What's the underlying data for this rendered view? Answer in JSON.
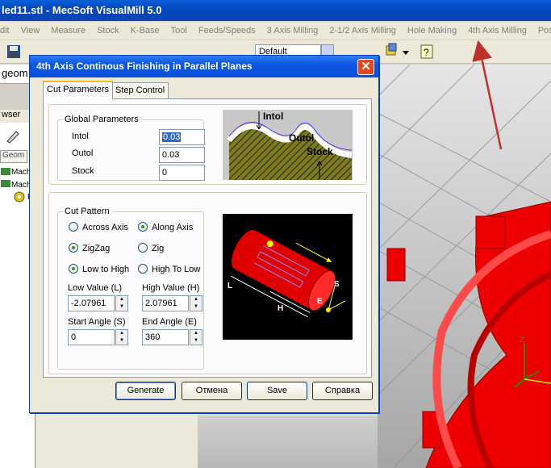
{
  "app": {
    "title": "led11.stl - MecSoft VisualMill 5.0",
    "menus": [
      "dit",
      "View",
      "Measure",
      "Stock",
      "K-Base",
      "Tool",
      "Feeds/Speeds",
      "3 Axis Milling",
      "2-1/2 Axis Milling",
      "Hole Making",
      "4th Axis Milling",
      "Post Pro"
    ],
    "toolbar_combo": "Default",
    "left_strip_text": "geom",
    "browser_caption": "wser",
    "geom_tab": "Geom",
    "tree": [
      "Mach",
      "Mach",
      "P"
    ]
  },
  "dialog": {
    "title": "4th Axis Continous Finishing in Parallel Planes",
    "close_label": "✕",
    "tabs": [
      "Cut Parameters",
      "Step Control"
    ],
    "global": {
      "legend": "Global Parameters",
      "intol_label": "Intol",
      "intol_value": "0.03",
      "outol_label": "Outol",
      "outol_value": "0.03",
      "stock_label": "Stock",
      "stock_value": "0"
    },
    "diagram_top": {
      "intol": "Intol",
      "outol": "Outol",
      "stock": "Stock"
    },
    "cut_pattern": {
      "legend": "Cut Pattern",
      "across_axis": "Across Axis",
      "along_axis": "Along Axis",
      "zigzag": "ZigZag",
      "zig": "Zig",
      "low_to_high": "Low to High",
      "high_to_low": "High To Low",
      "low_value_label": "Low Value (L)",
      "low_value": "-2.07961",
      "high_value_label": "High Value (H)",
      "high_value": "2.07961",
      "start_angle_label": "Start Angle (S)",
      "start_angle": "0",
      "end_angle_label": "End Angle (E)",
      "end_angle": "360"
    },
    "diagram_cyl": {
      "l": "L",
      "h": "H",
      "s": "S",
      "e": "E"
    },
    "buttons": {
      "generate": "Generate",
      "cancel": "Отмена",
      "save": "Save",
      "help": "Справка"
    }
  },
  "colors": {
    "part_red": "#ee0000",
    "annotation_arrow": "#c0302a",
    "title_blue": "#0a4fd8"
  }
}
